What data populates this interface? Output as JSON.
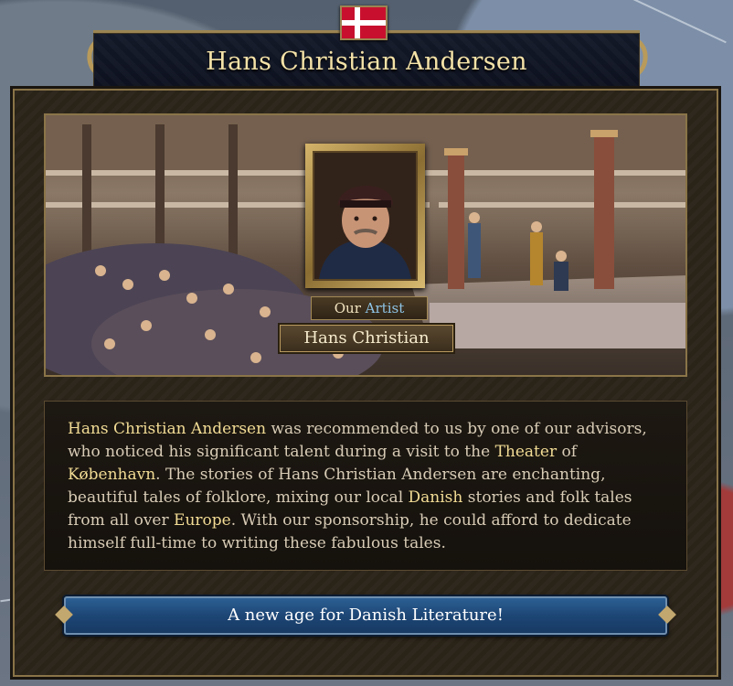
{
  "event": {
    "title": "Hans Christian Andersen",
    "role_prefix": "Our",
    "role": "Artist",
    "character_name": "Hans Christian",
    "description": [
      {
        "text": "Hans Christian Andersen",
        "hl": true
      },
      {
        "text": " was recommended to us by one of our advisors, who noticed his significant talent during a visit to the ",
        "hl": false
      },
      {
        "text": "Theater",
        "hl": true
      },
      {
        "text": " of ",
        "hl": false
      },
      {
        "text": "København",
        "hl": true
      },
      {
        "text": ". The stories of Hans Christian Andersen are enchanting, beautiful tales of folklore, mixing our local ",
        "hl": false
      },
      {
        "text": "Danish",
        "hl": true
      },
      {
        "text": " stories and folk tales from all over ",
        "hl": false
      },
      {
        "text": "Europe",
        "hl": true
      },
      {
        "text": ". With our sponsorship, he could afford to dedicate himself full-time to writing these fabulous tales.",
        "hl": false
      }
    ],
    "option_label": "A new age for Danish Literature!"
  },
  "colors": {
    "highlight": "#f2dc95",
    "role_accent": "#8ec4e6",
    "button": "#1d4675",
    "flag_red": "#c8102e"
  },
  "icons": {
    "flag": "denmark-flag-icon"
  }
}
